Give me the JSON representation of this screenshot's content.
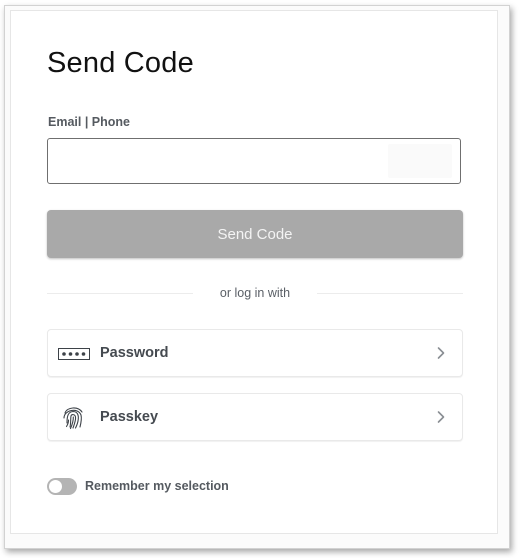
{
  "card": {
    "title": "Send Code",
    "email_field": {
      "label": "Email | Phone",
      "value": "",
      "placeholder": ""
    },
    "send_button_label": "Send Code",
    "divider_text": "or log in with",
    "methods": [
      {
        "label": "Password",
        "icon": "password-dots-icon"
      },
      {
        "label": "Passkey",
        "icon": "fingerprint-icon"
      }
    ],
    "remember": {
      "label": "Remember my selection",
      "enabled": false
    }
  },
  "colors": {
    "button_disabled": "#a9a9a9",
    "text_primary": "#111111",
    "text_secondary": "#555a60",
    "toggle_off": "#b4b4b4"
  }
}
